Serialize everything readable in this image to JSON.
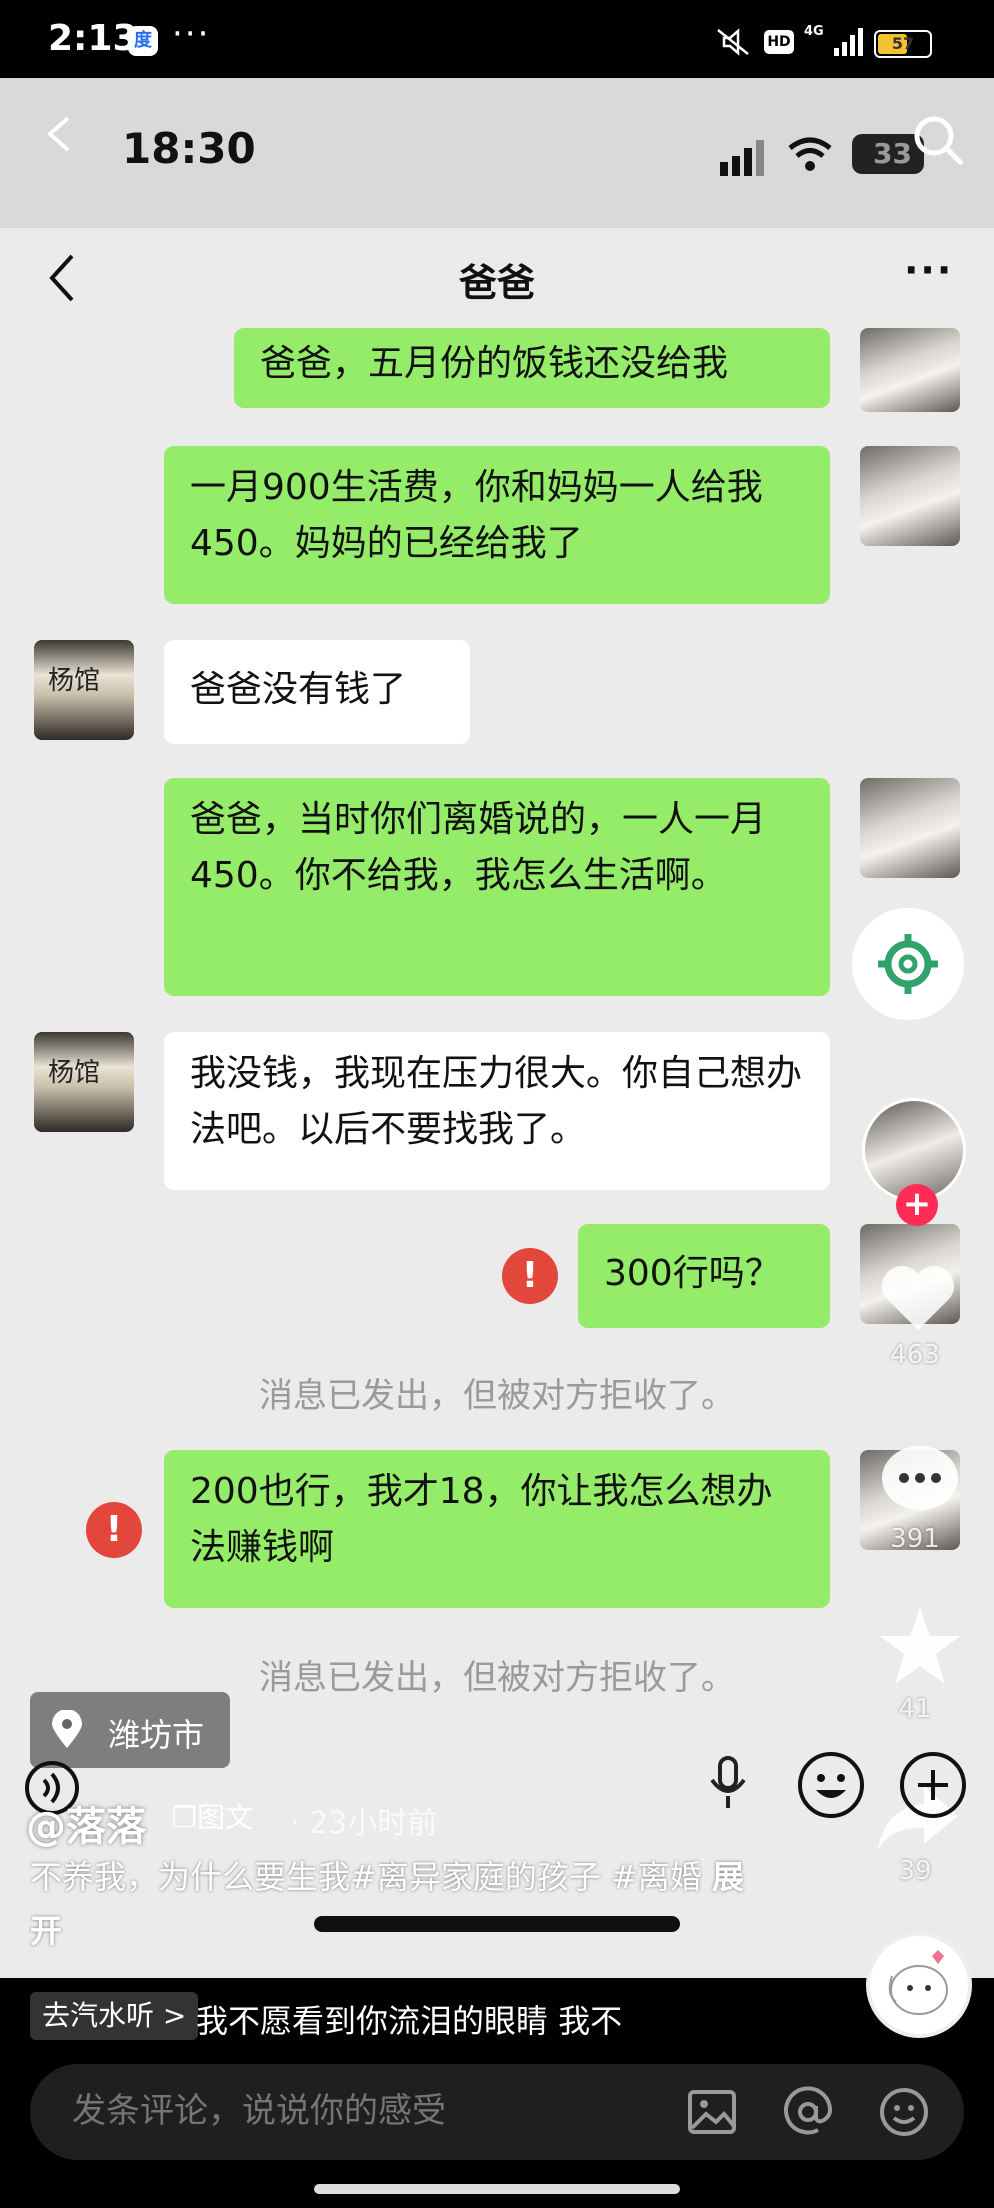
{
  "status_bar": {
    "time": "2:13",
    "app_icon": "baidu-icon",
    "more": "···",
    "hd": "HD",
    "network": "4G",
    "battery": "57",
    "battery_level": 57
  },
  "inner_status": {
    "time": "18:30",
    "battery": "33"
  },
  "chat": {
    "title": "爸爸",
    "more": "···",
    "messages": [
      {
        "from": "me",
        "text": "爸爸，五月份的饭钱还没给我"
      },
      {
        "from": "me",
        "text": "一月900生活费，你和妈妈一人给我450。妈妈的已经给我了"
      },
      {
        "from": "dad",
        "text": "爸爸没有钱了"
      },
      {
        "from": "me",
        "text": "爸爸，当时你们离婚说的，一人一月450。你不给我，我怎么生活啊。"
      },
      {
        "from": "dad",
        "text": "我没钱，我现在压力很大。你自己想办法吧。以后不要找我了。"
      },
      {
        "from": "me",
        "text": "300行吗？",
        "failed": true
      },
      {
        "from": "me",
        "text": "200也行，我才18，你让我怎么想办法赚钱啊",
        "failed": true
      }
    ],
    "rejected_notice": "消息已发出，但被对方拒收了。",
    "dad_avatar_text": "杨馆"
  },
  "overlay": {
    "like_count": "463",
    "comment_count": "391",
    "favorite_count": "41",
    "share_count": "39",
    "follow_symbol": "+",
    "location": "潍坊市",
    "author": "@落落",
    "post_type": "图文",
    "time_ago": "· 23小时前",
    "caption": "不养我，为什么要生我#离异家庭的孩子 #离婚",
    "caption_more": "展开"
  },
  "music": {
    "tag": "去汽水听 >",
    "title": "我不愿看到你流泪的眼睛    我不"
  },
  "comment": {
    "placeholder": "发条评论，说说你的感受",
    "error_mark": "!"
  },
  "colors": {
    "bubble_me": "#95ec69",
    "bubble_dad": "#ffffff",
    "error_red": "#e3473c",
    "follow_pink": "#ff2c55"
  }
}
